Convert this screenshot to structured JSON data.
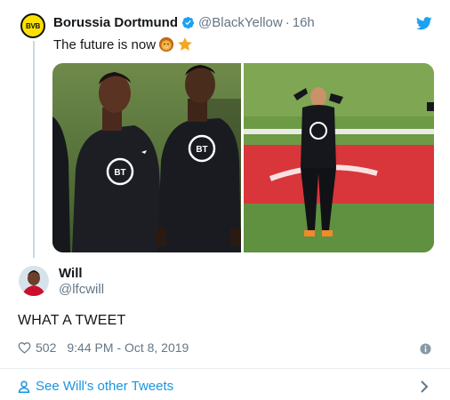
{
  "quoted_tweet": {
    "avatar_text": "BVB",
    "name": "Borussia Dortmund",
    "handle": "@BlackYellow",
    "separator": "·",
    "time": "16h",
    "text": "The future is now",
    "emojis": [
      "lion-face-emoji",
      "star-emoji"
    ],
    "media_shirt_logo": "BT"
  },
  "reply_tweet": {
    "name": "Will",
    "handle": "@lfcwill",
    "text": "WHAT A TWEET",
    "likes": "502",
    "timestamp": "9:44 PM - Oct 8, 2019"
  },
  "footer": {
    "see_more_label": "See Will's other Tweets"
  },
  "colors": {
    "link_blue": "#1b95e0",
    "twitter_blue": "#1da1f2",
    "muted_gray": "#657786",
    "divider": "#e6ecf0",
    "bvb_yellow": "#fde100"
  }
}
